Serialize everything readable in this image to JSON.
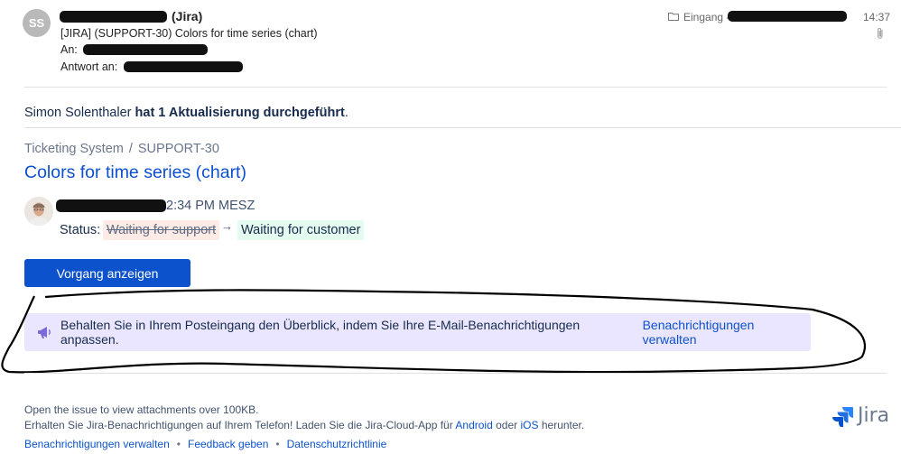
{
  "header": {
    "avatar_initials": "SS",
    "sender_suffix": "(Jira)",
    "subject": "[JIRA] (SUPPORT-30) Colors for time series (chart)",
    "to_label": "An:",
    "reply_to_label": "Antwort an:",
    "folder_label": "Eingang -",
    "time": "14:37",
    "attachment_icon": "paperclip-icon"
  },
  "body": {
    "update_user": "Simon Solenthaler",
    "update_action": "hat 1 Aktualisierung durchgeführt",
    "update_period": ".",
    "breadcrumb_project": "Ticketing System",
    "breadcrumb_sep": "/",
    "breadcrumb_issue": "SUPPORT-30",
    "issue_title": "Colors for time series (chart)",
    "update_time": "2:34 PM MESZ",
    "status_label": "Status:",
    "status_old": "Waiting for support",
    "status_arrow": "→",
    "status_new": "Waiting for customer",
    "view_button": "Vorgang anzeigen",
    "banner_text": "Behalten Sie in Ihrem Posteingang den Überblick, indem Sie Ihre E-Mail-Benachrichtigungen anpassen.",
    "banner_link": "Benachrichtigungen verwalten"
  },
  "footer": {
    "line1": "Open the issue to view attachments over 100KB.",
    "line2_pre": "Erhalten Sie Jira-Benachrichtigungen auf Ihrem Telefon! Laden Sie die Jira-Cloud-App für",
    "android": "Android",
    "oder": "oder",
    "ios": "iOS",
    "line2_post": "herunter.",
    "link_manage": "Benachrichtigungen verwalten",
    "link_feedback": "Feedback geben",
    "link_privacy": "Datenschutzrichtlinie",
    "dot": "•",
    "logo_text": "Jira"
  },
  "colors": {
    "link": "#0c52cc",
    "title": "#0c4fcf",
    "banner_bg": "#eae6ff",
    "old_status_bg": "#ffebe6",
    "new_status_bg": "#e3fcef"
  }
}
